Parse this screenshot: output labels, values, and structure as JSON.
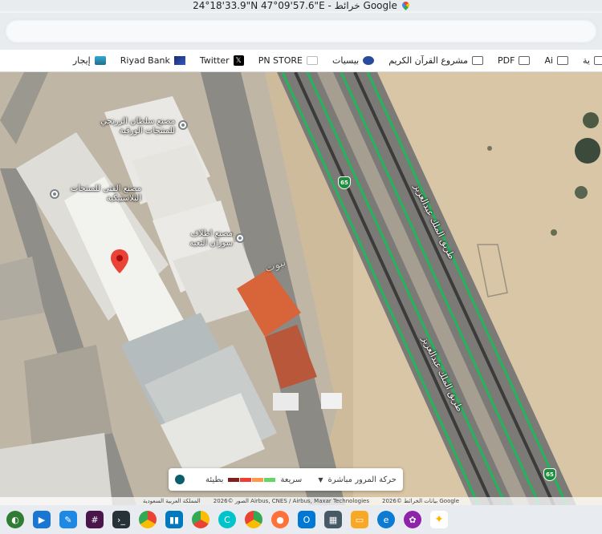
{
  "window": {
    "title": "24°18'33.9\"N 47°09'57.6\"E - خرائط Google"
  },
  "bookmarks": [
    {
      "label": "إيجار",
      "icon": "ijar-icon"
    },
    {
      "label": "Riyad Bank",
      "icon": "riyad-bank-icon"
    },
    {
      "label": "Twitter",
      "icon": "x-icon"
    },
    {
      "label": "PN STORE",
      "icon": "pn-store-icon"
    },
    {
      "label": "بيسيات",
      "icon": "bee-icon"
    },
    {
      "label": "مشروع القرآن الكريم",
      "icon": "folder-icon"
    },
    {
      "label": "PDF",
      "icon": "folder-icon"
    },
    {
      "label": "Ai",
      "icon": "folder-icon"
    },
    {
      "label": "ية",
      "icon": "folder-icon"
    }
  ],
  "map": {
    "places": [
      {
        "name": "مصنع سلطان الزرنجي للمنتجات الورقية"
      },
      {
        "name": "مصنع الفتى للمنتجات البلاستيكية"
      },
      {
        "name": "مصنع اطلاف سوزان التعبه"
      }
    ],
    "roads": [
      {
        "name": "طريق الملك عبدالعزيز"
      },
      {
        "name": "طريق الملك عبدالعزيز"
      }
    ],
    "route_shields": [
      "65",
      "65"
    ],
    "watermark": "بيوت"
  },
  "traffic_legend": {
    "title": "حركة المرور مباشرة",
    "fast": "سريعة",
    "slow": "بطيئة",
    "colors": [
      "#63d668",
      "#ff974d",
      "#f23c32",
      "#811f1f"
    ]
  },
  "attribution": {
    "left": "بيانات الخرائط ©2026 Google",
    "middle": "الصور ©2026 Airbus, CNES / Airbus, Maxar Technologies",
    "right": "المملكة العربية السعودية"
  },
  "taskbar": [
    {
      "icon": "copilot-icon",
      "color": "#2e7d32"
    },
    {
      "icon": "arrow-icon",
      "color": "#1976d2"
    },
    {
      "icon": "whiteboard-icon",
      "color": "#1e88e5"
    },
    {
      "icon": "slack-icon",
      "color": "#4a154b"
    },
    {
      "icon": "terminal-icon",
      "color": "#263238"
    },
    {
      "icon": "chrome-icon",
      "color": "#e53935"
    },
    {
      "icon": "trello-icon",
      "color": "#0079bf"
    },
    {
      "icon": "chrome-icon",
      "color": "#fbc02d"
    },
    {
      "icon": "canva-icon",
      "color": "#00c4cc"
    },
    {
      "icon": "chrome-icon",
      "color": "#43a047"
    },
    {
      "icon": "firefox-icon",
      "color": "#ff7139"
    },
    {
      "icon": "outlook-icon",
      "color": "#0078d4"
    },
    {
      "icon": "calculator-icon",
      "color": "#455a64"
    },
    {
      "icon": "folder-icon",
      "color": "#f9a825"
    },
    {
      "icon": "edge-icon",
      "color": "#0c7bd1"
    },
    {
      "icon": "photos-icon",
      "color": "#8e24aa"
    },
    {
      "icon": "sparkle-icon",
      "color": "#ffb300"
    }
  ]
}
